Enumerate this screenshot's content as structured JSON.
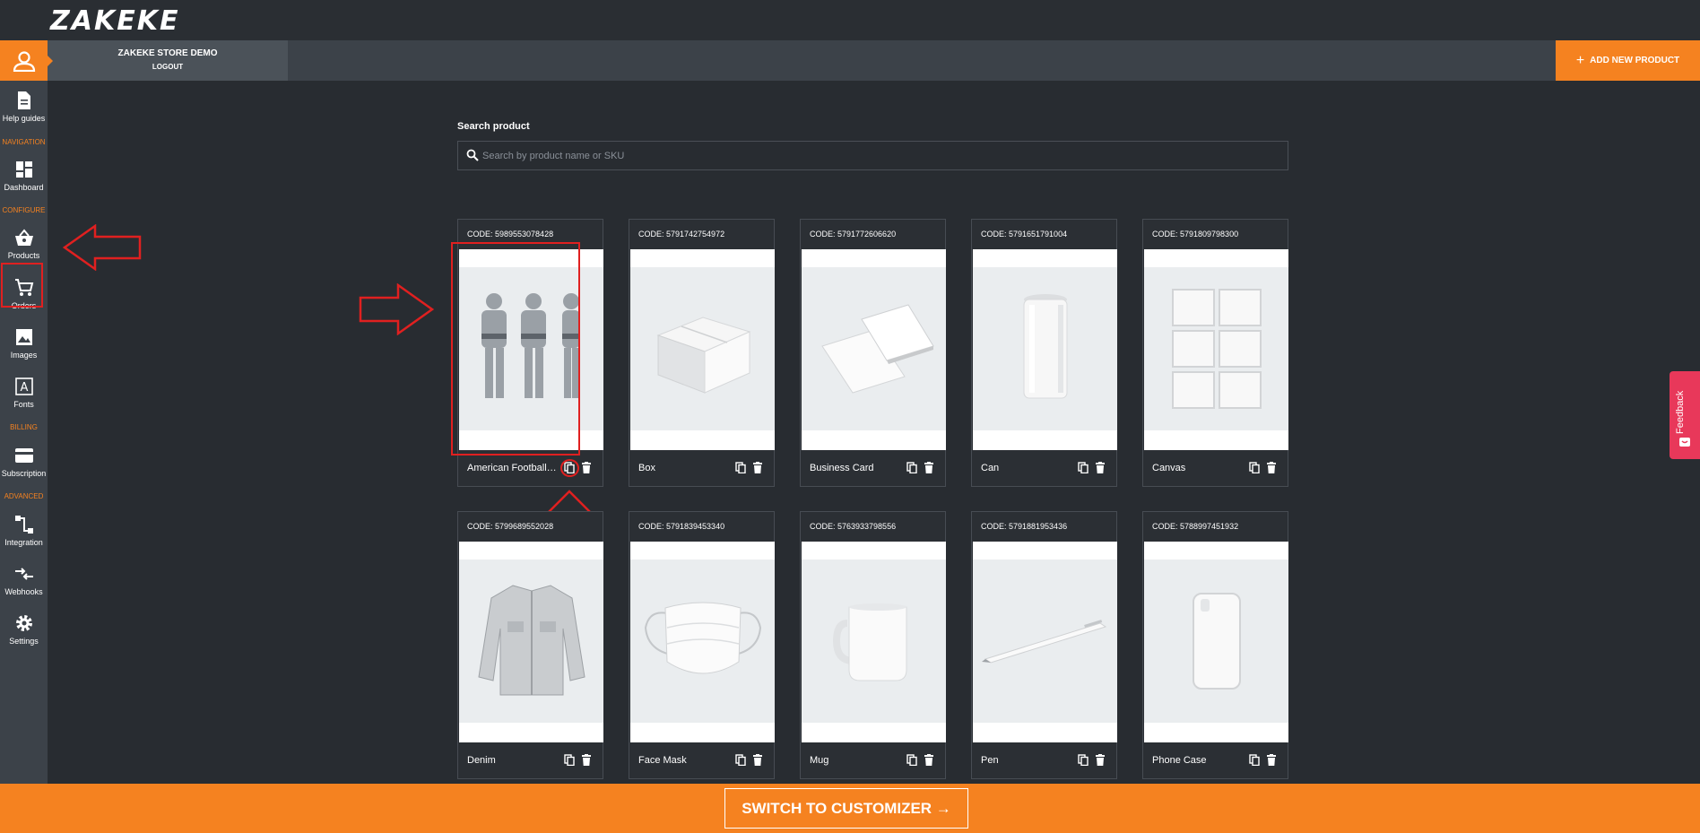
{
  "app": {
    "logo_text": "ZAKEKE"
  },
  "store": {
    "name": "ZAKEKE STORE DEMO",
    "logout_label": "LOGOUT"
  },
  "header": {
    "add_product_label": "ADD NEW PRODUCT"
  },
  "sidebar": {
    "help_label": "Help guides",
    "sections": {
      "navigation": "NAVIGATION",
      "configure": "CONFIGURE",
      "billing": "BILLING",
      "advanced": "ADVANCED"
    },
    "items": {
      "dashboard": "Dashboard",
      "products": "Products",
      "orders": "Orders",
      "images": "Images",
      "fonts": "Fonts",
      "subscription": "Subscription",
      "integration": "Integration",
      "webhooks": "Webhooks",
      "settings": "Settings"
    }
  },
  "search": {
    "label": "Search product",
    "placeholder": "Search by product name or SKU",
    "value": ""
  },
  "products": [
    {
      "code": "CODE: 5989553078428",
      "name": "American Football ...",
      "icon": "football-players-photo"
    },
    {
      "code": "CODE: 5791742754972",
      "name": "Box",
      "icon": "box-photo"
    },
    {
      "code": "CODE: 5791772606620",
      "name": "Business Card",
      "icon": "business-card-photo"
    },
    {
      "code": "CODE: 5791651791004",
      "name": "Can",
      "icon": "can-photo"
    },
    {
      "code": "CODE: 5791809798300",
      "name": "Canvas",
      "icon": "canvas-photo"
    },
    {
      "code": "CODE: 5799689552028",
      "name": "Denim",
      "icon": "denim-jacket-photo"
    },
    {
      "code": "CODE: 5791839453340",
      "name": "Face Mask",
      "icon": "face-mask-photo"
    },
    {
      "code": "CODE: 5763933798556",
      "name": "Mug",
      "icon": "mug-photo"
    },
    {
      "code": "CODE: 5791881953436",
      "name": "Pen",
      "icon": "pen-photo"
    },
    {
      "code": "CODE: 5788997451932",
      "name": "Phone Case",
      "icon": "phone-case-photo"
    }
  ],
  "feedback": {
    "label": "Feedback"
  },
  "footer": {
    "switch_label": "SWITCH TO CUSTOMIZER →"
  },
  "colors": {
    "accent": "#f58220",
    "background": "#282c31",
    "sidebar": "#3c4249",
    "annotation": "#e02020",
    "feedback": "#e8385a"
  }
}
